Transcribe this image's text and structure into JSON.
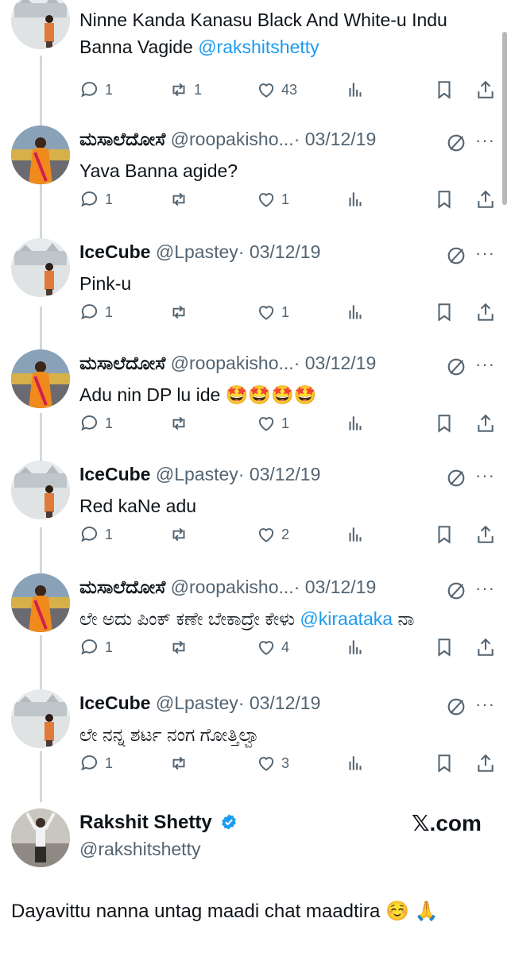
{
  "tweets": [
    {
      "name": "",
      "handle": "",
      "date": "",
      "text_parts": [
        "Ninne Kanda Kanasu Black And White-u Indu Banna Vagide ",
        "@rakshitshetty"
      ],
      "reply": "1",
      "retweet": "1",
      "like": "43",
      "avatar": "photo-bridge"
    },
    {
      "name": "ಮಸಾಲೆದೋಸೆ",
      "handle": "@roopakisho...",
      "date": "· 03/12/19",
      "text_parts": [
        "Yava Banna agide?",
        ""
      ],
      "reply": "1",
      "retweet": "",
      "like": "1",
      "avatar": "photo-saree"
    },
    {
      "name": "IceCube",
      "handle": "@Lpastey",
      "date": "· 03/12/19",
      "text_parts": [
        "Pink-u",
        ""
      ],
      "reply": "1",
      "retweet": "",
      "like": "1",
      "avatar": "photo-bridge"
    },
    {
      "name": "ಮಸಾಲೆದೋಸೆ",
      "handle": "@roopakisho...",
      "date": "· 03/12/19",
      "text_parts": [
        "Adu nin DP lu ide 🤩🤩🤩🤩",
        ""
      ],
      "reply": "1",
      "retweet": "",
      "like": "1",
      "avatar": "photo-saree"
    },
    {
      "name": "IceCube",
      "handle": "@Lpastey",
      "date": "· 03/12/19",
      "text_parts": [
        "Red kaNe adu",
        ""
      ],
      "reply": "1",
      "retweet": "",
      "like": "2",
      "avatar": "photo-bridge"
    },
    {
      "name": "ಮಸಾಲೆದೋಸೆ",
      "handle": "@roopakisho...",
      "date": "· 03/12/19",
      "text_parts": [
        "ಲೇ ಅದು ಪಿಂಕ್ ಕಣೇ ಬೇಕಾದ್ರೇ ಕೇಳು ",
        "@kiraataka",
        " ನಾ"
      ],
      "reply": "1",
      "retweet": "",
      "like": "4",
      "avatar": "photo-saree"
    },
    {
      "name": "IceCube",
      "handle": "@Lpastey",
      "date": "· 03/12/19",
      "text_parts": [
        "ಲೇ ನನ್ನ ಶರ್ಟ ನಂಗ ಗೋತ್ತಿಲ್ವಾ",
        ""
      ],
      "reply": "1",
      "retweet": "",
      "like": "3",
      "avatar": "photo-bridge"
    }
  ],
  "footer": {
    "name": "Rakshit Shetty",
    "handle": "@rakshitshetty",
    "watermark": "𝕏.com",
    "verified_color": "#1d9bf0"
  },
  "caption": "Dayavittu nanna untag maadi chat maadtira ☺️ 🙏",
  "icons": [
    "reply-icon",
    "retweet-icon",
    "like-icon",
    "views-icon",
    "bookmark-icon",
    "share-icon",
    "grok-icon",
    "more-icon",
    "verified-badge-icon"
  ],
  "colors": {
    "accent": "#1d9bf0",
    "muted": "#536471",
    "text": "#0f1419"
  }
}
